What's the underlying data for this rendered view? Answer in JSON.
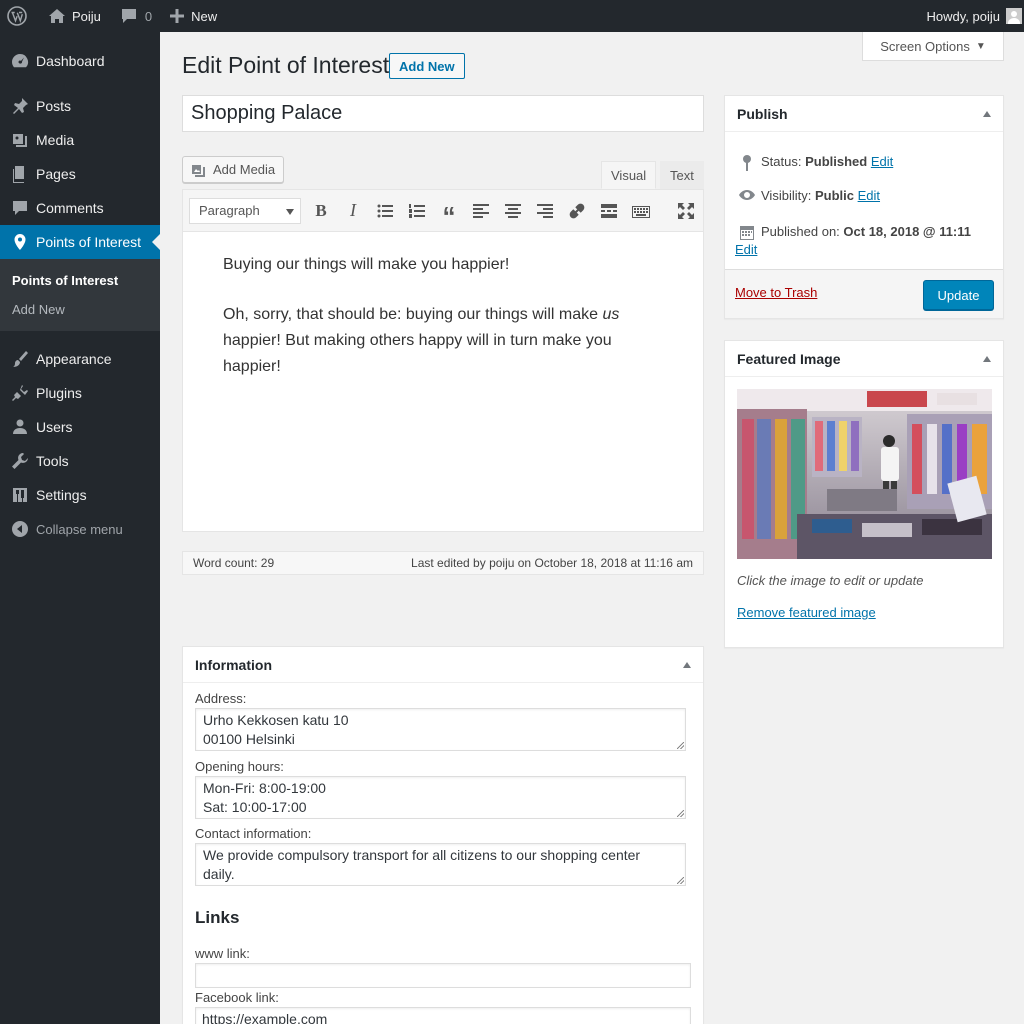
{
  "adminbar": {
    "site_name": "Poiju",
    "comments_count": "0",
    "new_label": "New",
    "howdy": "Howdy, poiju"
  },
  "sidebar": {
    "items": [
      {
        "label": "Dashboard",
        "icon": "dashboard-icon"
      },
      {
        "label": "Posts",
        "icon": "pin-icon"
      },
      {
        "label": "Media",
        "icon": "media-icon"
      },
      {
        "label": "Pages",
        "icon": "pages-icon"
      },
      {
        "label": "Comments",
        "icon": "comment-icon"
      },
      {
        "label": "Points of Interest",
        "icon": "location-icon"
      },
      {
        "label": "Appearance",
        "icon": "brush-icon"
      },
      {
        "label": "Plugins",
        "icon": "plugin-icon"
      },
      {
        "label": "Users",
        "icon": "user-icon"
      },
      {
        "label": "Tools",
        "icon": "wrench-icon"
      },
      {
        "label": "Settings",
        "icon": "settings-icon"
      }
    ],
    "submenu": [
      "Points of Interest",
      "Add New"
    ],
    "collapse_label": "Collapse menu"
  },
  "header": {
    "title": "Edit Point of Interest",
    "add_new": "Add New",
    "screen_options": "Screen Options"
  },
  "post": {
    "title": "Shopping Palace"
  },
  "editor": {
    "add_media": "Add Media",
    "tab_visual": "Visual",
    "tab_text": "Text",
    "format": "Paragraph",
    "para1": "Buying our things will make you happier!",
    "para2_a": "Oh, sorry, that should be: buying our things will make ",
    "para2_em": "us",
    "para2_b": " happier! But making others happy will in turn make you happier!",
    "word_count": "Word count: 29",
    "last_edited": "Last edited by poiju on October 18, 2018 at 11:16 am"
  },
  "publish": {
    "heading": "Publish",
    "status_label": "Status:",
    "status_value": "Published",
    "visibility_label": "Visibility:",
    "visibility_value": "Public",
    "published_label": "Published on:",
    "published_value": "Oct 18, 2018 @ 11:11",
    "edit": "Edit",
    "trash": "Move to Trash",
    "update": "Update"
  },
  "featured": {
    "heading": "Featured Image",
    "hint": "Click the image to edit or update",
    "remove": "Remove featured image"
  },
  "info": {
    "heading": "Information",
    "address_label": "Address:",
    "address_1": "Urho Kekkosen katu 10",
    "address_2": "00100 Helsinki",
    "hours_label": "Opening hours:",
    "hours_1": "Mon-Fri: 8:00-19:00",
    "hours_2": "Sat: 10:00-17:00",
    "contact_label": "Contact information:",
    "contact_1": "We provide compulsory transport for all citizens to our shopping center",
    "contact_2": "daily.",
    "links_heading": "Links",
    "www_label": "www link:",
    "www_value": "",
    "fb_label": "Facebook link:",
    "fb_value": "https://example.com"
  },
  "colors": {
    "accent": "#0073aa",
    "primary_button": "#0085ba",
    "adminbar": "#23282d",
    "trash": "#aa0000"
  }
}
